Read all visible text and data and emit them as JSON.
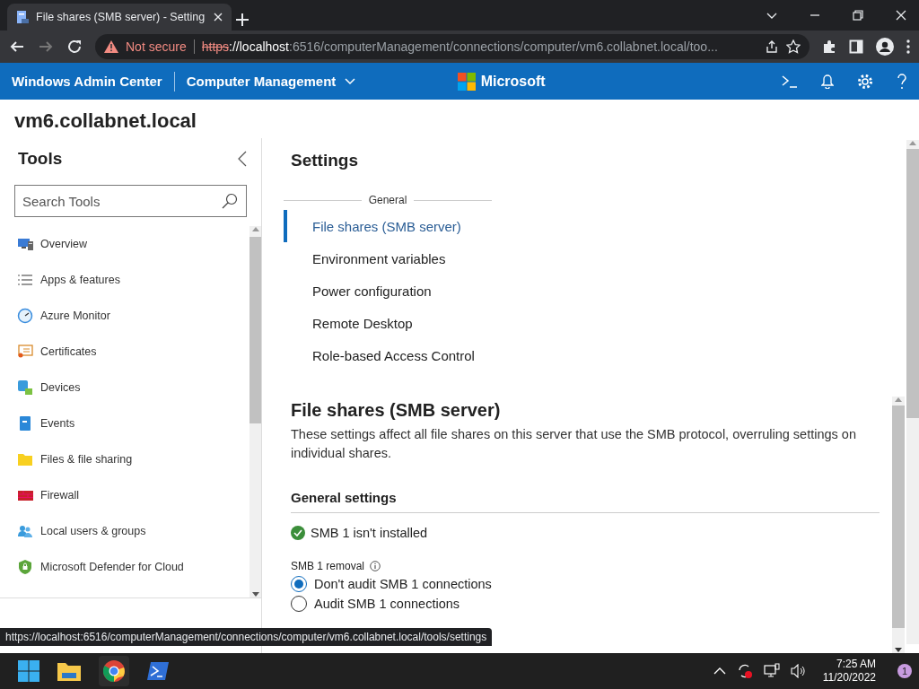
{
  "browser": {
    "tab_title": "File shares (SMB server) - Setting",
    "security": "Not secure",
    "url_scheme": "https",
    "url_host": "://localhost",
    "url_rest": ":6516/computerManagement/connections/computer/vm6.collabnet.local/too..."
  },
  "header": {
    "app_name": "Windows Admin Center",
    "tool": "Computer Management",
    "brand": "Microsoft"
  },
  "server": "vm6.collabnet.local",
  "tools": {
    "title": "Tools",
    "search_placeholder": "Search Tools",
    "items": [
      {
        "label": "Overview",
        "kind": "monitor"
      },
      {
        "label": "Apps & features",
        "kind": "list"
      },
      {
        "label": "Azure Monitor",
        "kind": "gauge"
      },
      {
        "label": "Certificates",
        "kind": "certificate"
      },
      {
        "label": "Devices",
        "kind": "devices"
      },
      {
        "label": "Events",
        "kind": "book"
      },
      {
        "label": "Files & file sharing",
        "kind": "folder"
      },
      {
        "label": "Firewall",
        "kind": "wall"
      },
      {
        "label": "Local users & groups",
        "kind": "users"
      },
      {
        "label": "Microsoft Defender for Cloud",
        "kind": "shield"
      }
    ]
  },
  "settings": {
    "title": "Settings",
    "group": "General",
    "items": [
      {
        "label": "File shares (SMB server)",
        "selected": true
      },
      {
        "label": "Environment variables",
        "selected": false
      },
      {
        "label": "Power configuration",
        "selected": false
      },
      {
        "label": "Remote Desktop",
        "selected": false
      },
      {
        "label": "Role-based Access Control",
        "selected": false
      }
    ]
  },
  "section": {
    "title": "File shares (SMB server)",
    "description": "These settings affect all file shares on this server that use the SMB protocol, overruling settings on individual shares.",
    "subheading": "General settings",
    "status": "SMB 1 isn't installed",
    "removal_label": "SMB 1 removal",
    "options": [
      {
        "label": "Don't audit SMB 1 connections",
        "selected": true
      },
      {
        "label": "Audit SMB 1 connections",
        "selected": false
      }
    ]
  },
  "status_url": "https://localhost:6516/computerManagement/connections/computer/vm6.collabnet.local/tools/settings",
  "taskbar": {
    "time": "7:25 AM",
    "date": "11/20/2022",
    "notifications": "1"
  }
}
